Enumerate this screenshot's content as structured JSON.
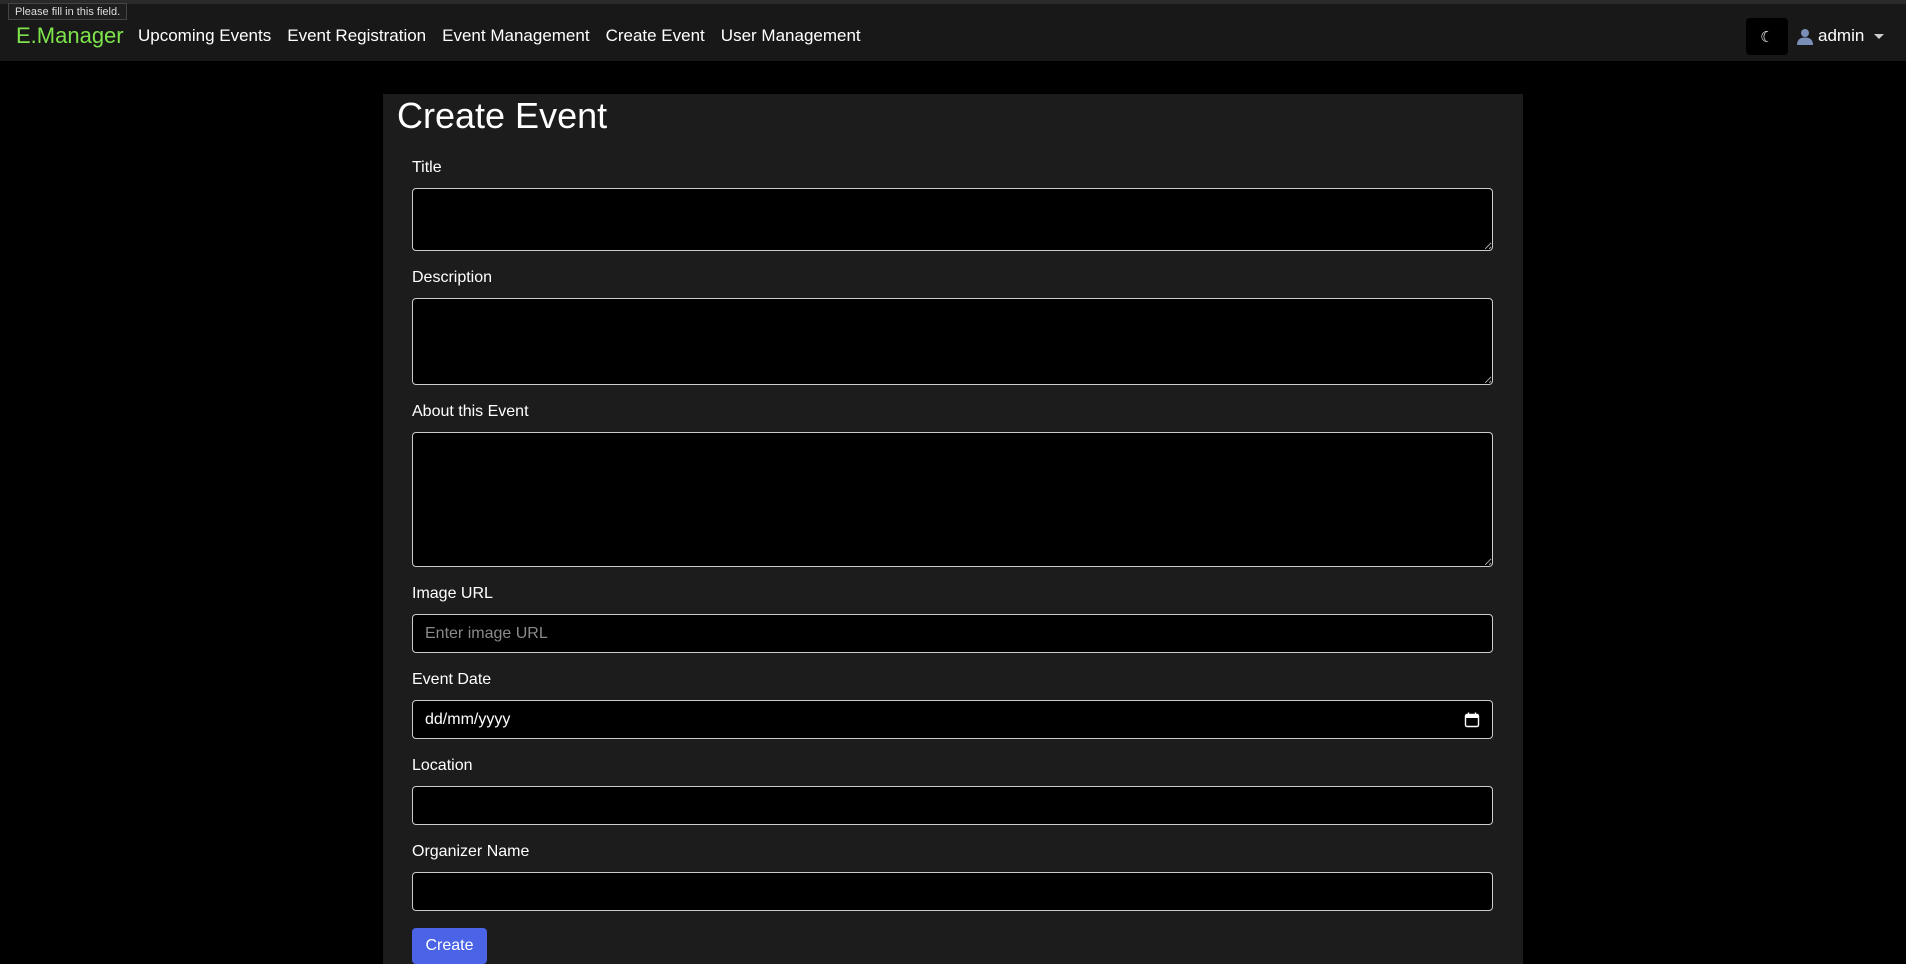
{
  "tooltip": "Please fill in this field.",
  "nav": {
    "brand": "E.Manager",
    "links": [
      "Upcoming Events",
      "Event Registration",
      "Event Management",
      "Create Event",
      "User Management"
    ],
    "theme_icon": "☾",
    "user": "admin"
  },
  "form": {
    "title": "Create Event",
    "fields": {
      "title": {
        "label": "Title",
        "value": ""
      },
      "description": {
        "label": "Description",
        "value": ""
      },
      "about": {
        "label": "About this Event",
        "value": ""
      },
      "image_url": {
        "label": "Image URL",
        "value": "",
        "placeholder": "Enter image URL"
      },
      "event_date": {
        "label": "Event Date",
        "value": "dd/mm/yyyy"
      },
      "location": {
        "label": "Location",
        "value": ""
      },
      "organizer": {
        "label": "Organizer Name",
        "value": ""
      }
    },
    "submit_label": "Create"
  },
  "colors": {
    "brand": "#7ee34b",
    "primary_button": "#4a63e7",
    "background": "#000000",
    "card": "#1c1c1c",
    "navbar": "#181818"
  },
  "icons": [
    "moon-icon",
    "user-icon",
    "chevron-down-icon",
    "calendar-icon"
  ]
}
